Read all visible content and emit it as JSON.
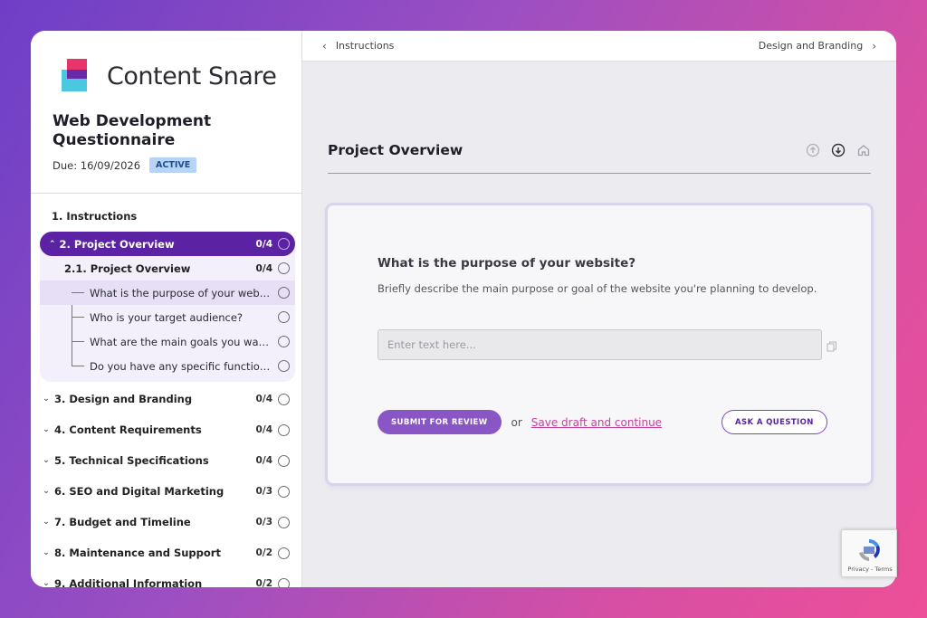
{
  "brand": {
    "name": "Content Snare"
  },
  "project": {
    "title": "Web Development Questionnaire",
    "due": "Due: 16/09/2026",
    "status": "ACTIVE"
  },
  "sidebar": {
    "instructions": "1. Instructions",
    "active_section": {
      "label": "2. Project Overview",
      "count": "0/4"
    },
    "sub_section": {
      "label": "2.1. Project Overview",
      "count": "0/4"
    },
    "questions": [
      "What is the purpose of your website?",
      "Who is your target audience?",
      "What are the main goals you want to achieve?",
      "Do you have any specific functionality in mind?"
    ],
    "sections": [
      {
        "label": "3. Design and Branding",
        "count": "0/4"
      },
      {
        "label": "4. Content Requirements",
        "count": "0/4"
      },
      {
        "label": "5. Technical Specifications",
        "count": "0/4"
      },
      {
        "label": "6. SEO and Digital Marketing",
        "count": "0/3"
      },
      {
        "label": "7. Budget and Timeline",
        "count": "0/3"
      },
      {
        "label": "8. Maintenance and Support",
        "count": "0/2"
      },
      {
        "label": "9. Additional Information",
        "count": "0/2"
      }
    ]
  },
  "topbar": {
    "prev": "Instructions",
    "next": "Design and Branding"
  },
  "main": {
    "section_title": "Project Overview",
    "question_title": "What is the purpose of your website?",
    "question_desc": "Briefly describe the main purpose or goal of the website you're planning to develop.",
    "answer_placeholder": "Enter text here...",
    "submit_label": "SUBMIT FOR REVIEW",
    "or_label": "or",
    "draft_label": "Save draft and continue",
    "ask_label": "ASK A QUESTION"
  },
  "recaptcha": {
    "text": "Privacy - Terms"
  },
  "colors": {
    "accent": "#5b23a3",
    "button": "#8a56c6",
    "link": "#c2439a",
    "badge": "#b7d3f5"
  }
}
